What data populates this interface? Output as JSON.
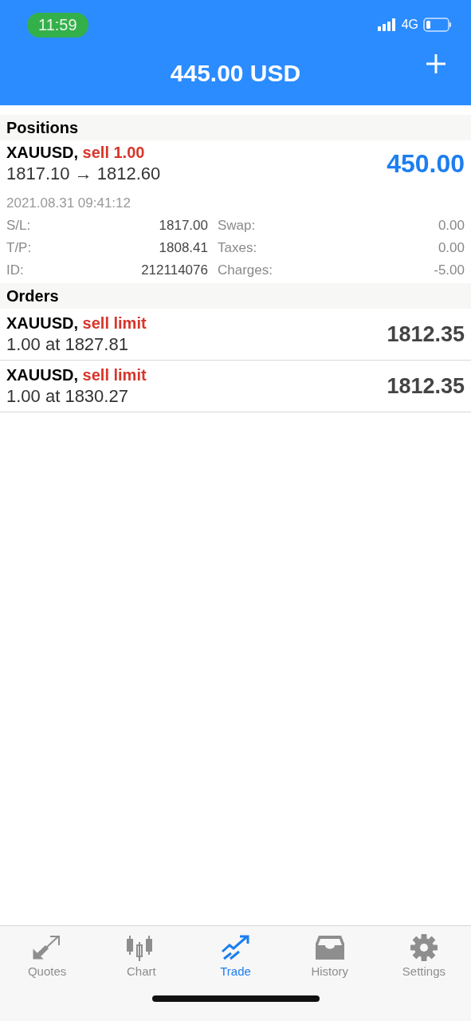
{
  "status_bar": {
    "time": "11:59",
    "network": "4G"
  },
  "header": {
    "title": "445.00 USD"
  },
  "positions": {
    "heading": "Positions",
    "items": [
      {
        "symbol": "XAUUSD,",
        "side": "sell 1.00",
        "prices": "1817.10 → 1812.60",
        "profit": "450.00",
        "time": "2021.08.31 09:41:12",
        "details": [
          {
            "label": "S/L:",
            "value": "1817.00"
          },
          {
            "label": "Swap:",
            "value": "0.00"
          },
          {
            "label": "T/P:",
            "value": "1808.41"
          },
          {
            "label": "Taxes:",
            "value": "0.00"
          },
          {
            "label": "ID:",
            "value": "212114076"
          },
          {
            "label": "Charges:",
            "value": "-5.00"
          }
        ]
      }
    ]
  },
  "orders": {
    "heading": "Orders",
    "items": [
      {
        "symbol": "XAUUSD,",
        "side": "sell limit",
        "detail": "1.00 at 1827.81",
        "price": "1812.35"
      },
      {
        "symbol": "XAUUSD,",
        "side": "sell limit",
        "detail": "1.00 at 1830.27",
        "price": "1812.35"
      }
    ]
  },
  "tabs": [
    {
      "label": "Quotes",
      "selected": false
    },
    {
      "label": "Chart",
      "selected": false
    },
    {
      "label": "Trade",
      "selected": true
    },
    {
      "label": "History",
      "selected": false
    },
    {
      "label": "Settings",
      "selected": false
    }
  ]
}
